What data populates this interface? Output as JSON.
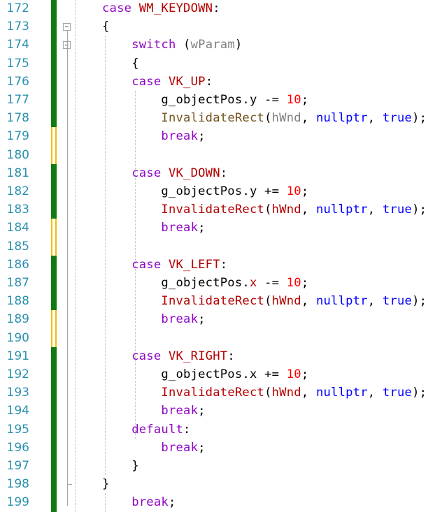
{
  "colors": {
    "line_number": "#2b91af",
    "keyword": "#8f08c4",
    "keyword_blue": "#0000ff",
    "macro": "#b30000",
    "identifier": "#000000",
    "param": "#808080",
    "number": "#ff0000",
    "function": "#74531f",
    "saved_change": "#107c10",
    "unsaved_change": "#f0c000"
  },
  "lines": [
    {
      "num": "172",
      "change": "saved",
      "fold": "",
      "tokens": [
        [
          "case ",
          "kw"
        ],
        [
          "WM_KEYDOWN",
          "mac"
        ],
        [
          ":",
          "id"
        ]
      ]
    },
    {
      "num": "173",
      "change": "saved",
      "fold": "box",
      "tokens": [
        [
          "{",
          "id"
        ]
      ]
    },
    {
      "num": "174",
      "change": "saved",
      "fold": "box",
      "tokens": [
        [
          "    ",
          "id"
        ],
        [
          "switch",
          "kw"
        ],
        [
          " (",
          "id"
        ],
        [
          "wParam",
          "par"
        ],
        [
          ")",
          "id"
        ]
      ]
    },
    {
      "num": "175",
      "change": "saved",
      "fold": "",
      "tokens": [
        [
          "    {",
          "id"
        ]
      ]
    },
    {
      "num": "176",
      "change": "saved",
      "fold": "",
      "tokens": [
        [
          "    case ",
          "kw"
        ],
        [
          "VK_UP",
          "mac"
        ],
        [
          ":",
          "id"
        ]
      ]
    },
    {
      "num": "177",
      "change": "saved",
      "fold": "",
      "tokens": [
        [
          "        g_objectPos.y -= ",
          "id"
        ],
        [
          "10",
          "num"
        ],
        [
          ";",
          "id"
        ]
      ]
    },
    {
      "num": "178",
      "change": "saved",
      "fold": "",
      "tokens": [
        [
          "        ",
          "id"
        ],
        [
          "InvalidateRect",
          "fn"
        ],
        [
          "(",
          "id"
        ],
        [
          "hWnd",
          "par"
        ],
        [
          ", ",
          "id"
        ],
        [
          "nullptr",
          "kwb"
        ],
        [
          ", ",
          "id"
        ],
        [
          "true",
          "kwb"
        ],
        [
          ");",
          "id"
        ]
      ]
    },
    {
      "num": "179",
      "change": "unsaved",
      "fold": "",
      "tokens": [
        [
          "        ",
          "id"
        ],
        [
          "break",
          "kw"
        ],
        [
          ";",
          "id"
        ]
      ]
    },
    {
      "num": "180",
      "change": "unsaved",
      "fold": "",
      "tokens": []
    },
    {
      "num": "181",
      "change": "saved",
      "fold": "",
      "tokens": [
        [
          "    case ",
          "kw"
        ],
        [
          "VK_DOWN",
          "mac"
        ],
        [
          ":",
          "id"
        ]
      ]
    },
    {
      "num": "182",
      "change": "saved",
      "fold": "",
      "tokens": [
        [
          "        g_objectPos.y += ",
          "id"
        ],
        [
          "10",
          "num"
        ],
        [
          ";",
          "id"
        ]
      ]
    },
    {
      "num": "183",
      "change": "saved",
      "fold": "",
      "tokens": [
        [
          "        ",
          "id"
        ],
        [
          "InvalidateRect",
          "mac"
        ],
        [
          "(",
          "id"
        ],
        [
          "hWnd",
          "mac"
        ],
        [
          ", ",
          "id"
        ],
        [
          "nullptr",
          "kwb"
        ],
        [
          ", ",
          "id"
        ],
        [
          "true",
          "kwb"
        ],
        [
          ");",
          "id"
        ]
      ]
    },
    {
      "num": "184",
      "change": "unsaved",
      "fold": "",
      "tokens": [
        [
          "        ",
          "id"
        ],
        [
          "break",
          "kw"
        ],
        [
          ";",
          "id"
        ]
      ]
    },
    {
      "num": "185",
      "change": "unsaved",
      "fold": "",
      "tokens": []
    },
    {
      "num": "186",
      "change": "saved",
      "fold": "",
      "tokens": [
        [
          "    case ",
          "kw"
        ],
        [
          "VK_LEFT",
          "mac"
        ],
        [
          ":",
          "id"
        ]
      ]
    },
    {
      "num": "187",
      "change": "saved",
      "fold": "",
      "tokens": [
        [
          "        g_objectPos.",
          "id"
        ],
        [
          "x",
          "mac"
        ],
        [
          " -= ",
          "id"
        ],
        [
          "10",
          "num"
        ],
        [
          ";",
          "id"
        ]
      ]
    },
    {
      "num": "188",
      "change": "saved",
      "fold": "",
      "tokens": [
        [
          "        ",
          "id"
        ],
        [
          "InvalidateRect",
          "mac"
        ],
        [
          "(",
          "id"
        ],
        [
          "hWnd",
          "mac"
        ],
        [
          ", ",
          "id"
        ],
        [
          "nullptr",
          "kwb"
        ],
        [
          ", ",
          "id"
        ],
        [
          "true",
          "kwb"
        ],
        [
          ");",
          "id"
        ]
      ]
    },
    {
      "num": "189",
      "change": "unsaved",
      "fold": "",
      "tokens": [
        [
          "        ",
          "id"
        ],
        [
          "break",
          "kw"
        ],
        [
          ";",
          "id"
        ]
      ]
    },
    {
      "num": "190",
      "change": "unsaved",
      "fold": "",
      "tokens": []
    },
    {
      "num": "191",
      "change": "saved",
      "fold": "",
      "tokens": [
        [
          "    case ",
          "kw"
        ],
        [
          "VK_RIGHT",
          "mac"
        ],
        [
          ":",
          "id"
        ]
      ]
    },
    {
      "num": "192",
      "change": "saved",
      "fold": "",
      "tokens": [
        [
          "        g_objectPos.x += ",
          "id"
        ],
        [
          "10",
          "num"
        ],
        [
          ";",
          "id"
        ]
      ]
    },
    {
      "num": "193",
      "change": "saved",
      "fold": "",
      "tokens": [
        [
          "        ",
          "id"
        ],
        [
          "InvalidateRect",
          "mac"
        ],
        [
          "(",
          "id"
        ],
        [
          "hWnd",
          "mac"
        ],
        [
          ", ",
          "id"
        ],
        [
          "nullptr",
          "kwb"
        ],
        [
          ", ",
          "id"
        ],
        [
          "true",
          "kwb"
        ],
        [
          ");",
          "id"
        ]
      ]
    },
    {
      "num": "194",
      "change": "saved",
      "fold": "",
      "tokens": [
        [
          "        ",
          "id"
        ],
        [
          "break",
          "kw"
        ],
        [
          ";",
          "id"
        ]
      ]
    },
    {
      "num": "195",
      "change": "saved",
      "fold": "",
      "tokens": [
        [
          "    ",
          "id"
        ],
        [
          "default",
          "kw"
        ],
        [
          ":",
          "id"
        ]
      ]
    },
    {
      "num": "196",
      "change": "saved",
      "fold": "",
      "tokens": [
        [
          "        ",
          "id"
        ],
        [
          "break",
          "kw"
        ],
        [
          ";",
          "id"
        ]
      ]
    },
    {
      "num": "197",
      "change": "saved",
      "fold": "",
      "tokens": [
        [
          "    }",
          "id"
        ]
      ]
    },
    {
      "num": "198",
      "change": "saved",
      "fold": "end",
      "tokens": [
        [
          "}",
          "id"
        ]
      ]
    },
    {
      "num": "199",
      "change": "saved",
      "fold": "",
      "tokens": [
        [
          "    ",
          "id"
        ],
        [
          "break",
          "kw"
        ],
        [
          ";",
          "id"
        ]
      ]
    }
  ]
}
